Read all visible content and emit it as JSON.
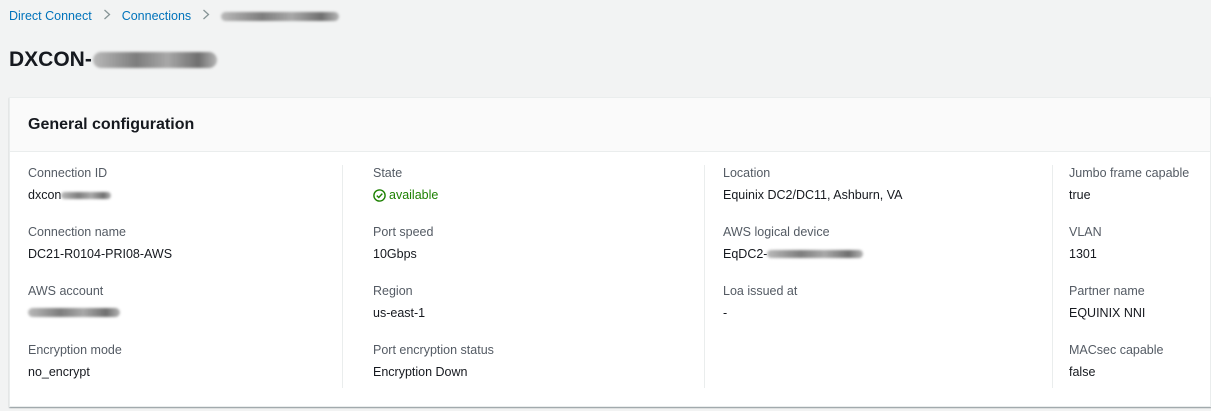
{
  "breadcrumb": {
    "items": [
      "Direct Connect",
      "Connections"
    ],
    "separator": ">"
  },
  "page": {
    "title_prefix": "DXCON-"
  },
  "panel": {
    "title": "General configuration",
    "columns": [
      [
        {
          "label": "Connection ID",
          "value": "dxcon"
        },
        {
          "label": "Connection name",
          "value": "DC21-R0104-PRI08-AWS"
        },
        {
          "label": "AWS account",
          "value": ""
        },
        {
          "label": "Encryption mode",
          "value": "no_encrypt"
        }
      ],
      [
        {
          "label": "State",
          "value": "available"
        },
        {
          "label": "Port speed",
          "value": "10Gbps"
        },
        {
          "label": "Region",
          "value": "us-east-1"
        },
        {
          "label": "Port encryption status",
          "value": "Encryption Down"
        }
      ],
      [
        {
          "label": "Location",
          "value": "Equinix DC2/DC11, Ashburn, VA"
        },
        {
          "label": "AWS logical device",
          "value": "EqDC2-"
        },
        {
          "label": "Loa issued at",
          "value": "-"
        }
      ],
      [
        {
          "label": "Jumbo frame capable",
          "value": "true"
        },
        {
          "label": "VLAN",
          "value": "1301"
        },
        {
          "label": "Partner name",
          "value": "EQUINIX NNI"
        },
        {
          "label": "MACsec capable",
          "value": "false"
        }
      ]
    ]
  },
  "colors": {
    "link": "#0073bb",
    "status_ok": "#1d8102",
    "label": "#545b64"
  },
  "icons": {
    "state": "status-positive-icon",
    "breadcrumb_separator": "chevron-right-icon"
  }
}
